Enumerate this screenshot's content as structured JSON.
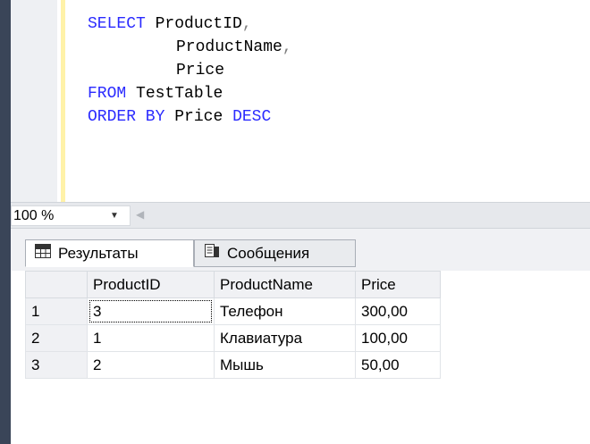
{
  "editor": {
    "query": {
      "select_kw": "SELECT",
      "col1": "ProductID",
      "comma1": ",",
      "col2": "ProductName",
      "comma2": ",",
      "col3": "Price",
      "from_kw": "FROM",
      "table": "TestTable",
      "order_kw": "ORDER BY",
      "order_col": "Price",
      "desc_kw": "DESC"
    }
  },
  "zoom": {
    "value": "100 %",
    "dropdown_icon": "chevron-down"
  },
  "tabs": [
    {
      "label": "Результаты",
      "icon": "grid-icon",
      "active": true
    },
    {
      "label": "Сообщения",
      "icon": "messages-icon",
      "active": false
    }
  ],
  "grid": {
    "columns": [
      "ProductID",
      "ProductName",
      "Price"
    ],
    "rows": [
      {
        "num": "1",
        "cells": [
          "3",
          "Телефон",
          "300,00"
        ]
      },
      {
        "num": "2",
        "cells": [
          "1",
          "Клавиатура",
          "100,00"
        ]
      },
      {
        "num": "3",
        "cells": [
          "2",
          "Мышь",
          "50,00"
        ]
      }
    ]
  },
  "colors": {
    "keyword": "#2b2bff",
    "punctuation": "#808080",
    "change_bar": "#fff2a8"
  }
}
